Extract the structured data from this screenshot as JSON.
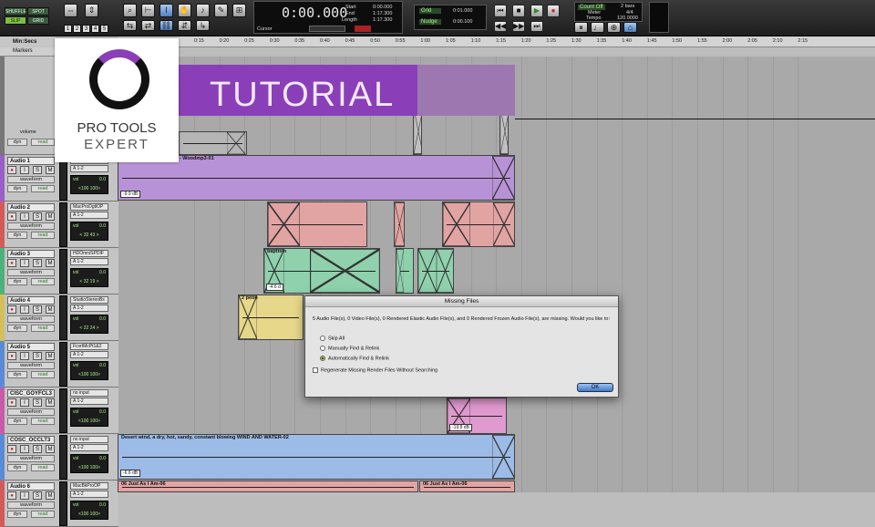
{
  "toolbar": {
    "modes": [
      "SHUFFLE",
      "SPOT",
      "SLIP",
      "GRID"
    ],
    "zoom_presets": [
      "1",
      "2",
      "3",
      "4",
      "5"
    ],
    "main_counter": "0:00.000",
    "start_label": "Start",
    "start_value": "0:00.000",
    "end_label": "End",
    "end_value": "1:17.300",
    "length_label": "Length",
    "length_value": "1:17.300",
    "cursor_label": "Cursor",
    "grid_label": "Grid",
    "grid_value": "0:01.000",
    "nudge_label": "Nudge",
    "nudge_value": "0:00.100",
    "count_off_label": "Count Off",
    "count_off_value": "2 bars",
    "meter_label": "Meter",
    "meter_value": "4/4",
    "tempo_label": "Tempo",
    "tempo_value": "120.0000"
  },
  "ruler": {
    "label": "Min:Secs",
    "markers_label": "Markers",
    "ticks": [
      "0:15",
      "0:20",
      "0:25",
      "0:30",
      "0:35",
      "0:40",
      "0:45",
      "0:50",
      "0:55",
      "1:00",
      "1:05",
      "1:10",
      "1:15",
      "1:20",
      "1:25",
      "1:30",
      "1:35",
      "1:40",
      "1:45",
      "1:50",
      "1:55",
      "2:00",
      "2:05",
      "2:10",
      "2:15"
    ]
  },
  "branding": {
    "tutorial": "TUTORIAL",
    "logo_line1": "PRO TOOLS",
    "logo_line2": "EXPERT"
  },
  "tracks": [
    {
      "name": "Audio 1",
      "insert": "",
      "io": "A 1-2",
      "view": "waveform",
      "auto": "dyn",
      "mode": "read",
      "vol": "0.0",
      "pan": "<100  100>",
      "color": "#9a5ec8"
    },
    {
      "name": "Audio 2",
      "insert": "MacProDgtlOP",
      "io": "A 1-2",
      "view": "waveform",
      "auto": "dyn",
      "mode": "read",
      "vol": "0.0",
      "pan": "< 32    43 >",
      "color": "#d45a5a"
    },
    {
      "name": "Audio 3",
      "insert": "HDOmniSPDIF",
      "io": "A 1-2",
      "view": "waveform",
      "auto": "dyn",
      "mode": "read",
      "vol": "0.0",
      "pan": "< 32    19 >",
      "color": "#4fb17a"
    },
    {
      "name": "Audio 4",
      "insert": "StudioStereoBs",
      "io": "A 1-2",
      "view": "waveform",
      "auto": "dyn",
      "mode": "read",
      "vol": "0.0",
      "pan": "< 22    24 >",
      "color": "#d4c05a"
    },
    {
      "name": "Audio 5",
      "insert": "FcsrtMcPt1&2",
      "io": "A 1-2",
      "view": "waveform",
      "auto": "dyn",
      "mode": "read",
      "vol": "0.0",
      "pan": "<100  100>",
      "color": "#5a8ad4"
    },
    {
      "name": "CISC_GOYFCL3",
      "insert": "no input",
      "io": "A 1-2",
      "view": "waveform",
      "auto": "dyn",
      "mode": "read",
      "vol": "0.0",
      "pan": "<100  100>",
      "color": "#c85aa8"
    },
    {
      "name": "COSC_OCCLT3",
      "insert": "no input",
      "io": "A 1-2",
      "view": "waveform",
      "auto": "dyn",
      "mode": "read",
      "vol": "0.0",
      "pan": "<100  100>",
      "color": "#5a8ad4"
    },
    {
      "name": "Audio 6",
      "insert": "MacBkProOP",
      "io": "A 1-2",
      "view": "waveform",
      "auto": "dyn",
      "mode": "read",
      "vol": "0.0",
      "pan": "<100  100>",
      "color": "#d45a5a"
    }
  ],
  "top_track": {
    "volume_label": "volume",
    "auto": "dyn",
    "mode": "read"
  },
  "clips": {
    "audio1": "ll Beach - Distant - Laps - Woodmp3-01",
    "audio1_gain": "-9.9 dB",
    "audio3_label": "baptism",
    "audio3_gain": "-4.6 d",
    "audio4_label": "2 peop",
    "cisc_gain": "-19.8 dB",
    "cosc": "Desert wind, a dry, hot, sandy, constant blowing WIND AND WATER-02",
    "cosc_gain": "-6.6 dB",
    "audio6_a": "06 Just As I Am-06",
    "audio6_b": "06 Just As I Am-06"
  },
  "dialog": {
    "title": "Missing Files",
    "message": "5 Audio File(s), 0 Video File(s), 0 Rendered Elastic Audio File(s), and 0 Rendered Frozen Audio File(s), are missing. Would you like to:",
    "options": [
      "Skip All",
      "Manually Find & Relink",
      "Automatically Find & Relink"
    ],
    "selected_option": "Automatically Find & Relink",
    "checkbox_label": "Regenerate Missing Render Files Without Searching",
    "ok_label": "OK"
  }
}
